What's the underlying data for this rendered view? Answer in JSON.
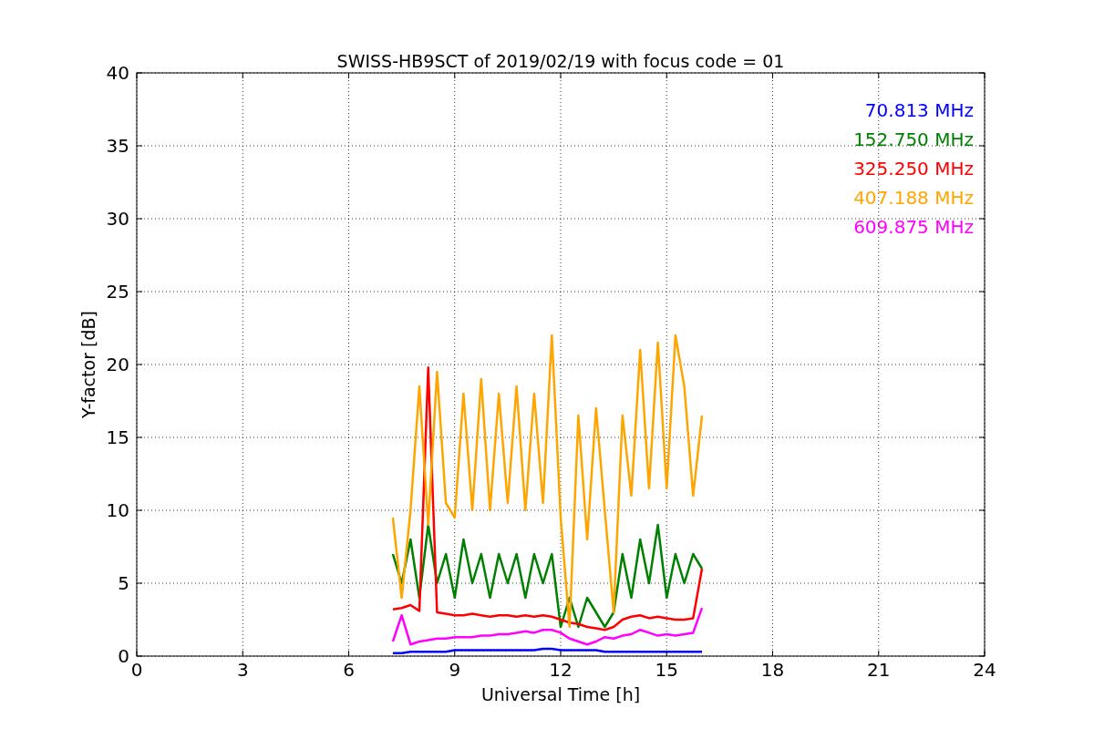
{
  "chart_data": {
    "type": "line",
    "title": "SWISS-HB9SCT of 2019/02/19 with focus code = 01",
    "xlabel": "Universal Time [h]",
    "ylabel": "Y-factor [dB]",
    "x": [
      7.25,
      7.5,
      7.75,
      8,
      8.25,
      8.5,
      8.75,
      9,
      9.25,
      9.5,
      9.75,
      10,
      10.25,
      10.5,
      10.75,
      11,
      11.25,
      11.5,
      11.75,
      12,
      12.25,
      12.5,
      12.75,
      13,
      13.25,
      13.5,
      13.75,
      14,
      14.25,
      14.5,
      14.75,
      15,
      15.25,
      15.5,
      15.75,
      16
    ],
    "grid": true,
    "xlim": [
      0,
      24
    ],
    "ylim": [
      0,
      40
    ],
    "xticks": [
      0,
      3,
      6,
      9,
      12,
      15,
      18,
      21,
      24
    ],
    "yticks": [
      0,
      5,
      10,
      15,
      20,
      25,
      30,
      35,
      40
    ],
    "series": [
      {
        "name": "70.813 MHz",
        "color": "#0000ff",
        "values": [
          0.2,
          0.2,
          0.3,
          0.3,
          0.3,
          0.3,
          0.3,
          0.4,
          0.4,
          0.4,
          0.4,
          0.4,
          0.4,
          0.4,
          0.4,
          0.4,
          0.4,
          0.5,
          0.5,
          0.4,
          0.4,
          0.4,
          0.4,
          0.4,
          0.3,
          0.3,
          0.3,
          0.3,
          0.3,
          0.3,
          0.3,
          0.3,
          0.3,
          0.3,
          0.3,
          0.3
        ]
      },
      {
        "name": "152.750 MHz",
        "color": "#008000",
        "values": [
          7,
          5,
          8,
          4,
          9,
          5,
          7,
          4,
          8,
          5,
          7,
          4,
          7,
          5,
          7,
          4,
          7,
          5,
          7,
          2,
          4,
          2,
          4,
          3,
          2,
          3,
          7,
          4,
          8,
          5,
          9,
          4,
          7,
          5,
          7,
          6
        ]
      },
      {
        "name": "325.250 MHz",
        "color": "#ff0000",
        "values": [
          3.2,
          3.3,
          3.5,
          3.1,
          19.8,
          3,
          2.9,
          2.8,
          2.8,
          2.9,
          2.8,
          2.7,
          2.8,
          2.8,
          2.7,
          2.8,
          2.7,
          2.8,
          2.7,
          2.5,
          2.3,
          2.2,
          2,
          1.9,
          1.8,
          2,
          2.5,
          2.7,
          2.8,
          2.6,
          2.7,
          2.6,
          2.5,
          2.5,
          2.6,
          6
        ]
      },
      {
        "name": "407.188 MHz",
        "color": "#ffa500",
        "values": [
          9.5,
          4,
          10,
          18.5,
          9,
          19.5,
          10.5,
          9.5,
          18,
          10,
          19,
          10,
          18,
          10.5,
          18.5,
          10,
          18,
          10.5,
          22,
          9.5,
          2,
          16.5,
          8,
          17,
          10,
          3,
          16.5,
          11,
          21,
          11.5,
          21.5,
          11.5,
          22,
          18.5,
          11,
          16.5
        ]
      },
      {
        "name": "609.875 MHz",
        "color": "#ff00ff",
        "values": [
          1,
          2.8,
          0.8,
          1,
          1.1,
          1.2,
          1.2,
          1.3,
          1.3,
          1.3,
          1.4,
          1.4,
          1.5,
          1.5,
          1.6,
          1.7,
          1.6,
          1.8,
          1.8,
          1.6,
          1.2,
          1,
          0.8,
          1,
          1.3,
          1.2,
          1.4,
          1.5,
          1.8,
          1.6,
          1.4,
          1.5,
          1.4,
          1.5,
          1.6,
          3.3
        ]
      }
    ]
  }
}
